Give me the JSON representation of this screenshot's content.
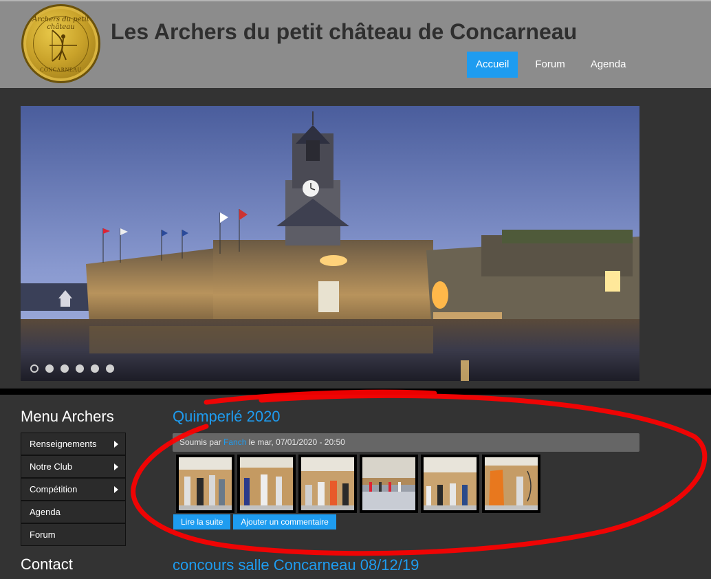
{
  "header": {
    "site_title": "Les Archers du petit château de Concarneau",
    "logo_text_top": "Archers du petit château",
    "logo_text_bottom": "CONCARNEAU"
  },
  "nav": {
    "items": [
      {
        "label": "Accueil",
        "active": true
      },
      {
        "label": "Forum",
        "active": false
      },
      {
        "label": "Agenda",
        "active": false
      }
    ]
  },
  "slider": {
    "image_icon": "castle-photo",
    "slide_count": 6,
    "active_slide": 1
  },
  "sidebar": {
    "menu_title": "Menu Archers",
    "items": [
      {
        "label": "Renseignements",
        "has_submenu": true
      },
      {
        "label": "Notre Club",
        "has_submenu": true
      },
      {
        "label": "Compétition",
        "has_submenu": true
      },
      {
        "label": "Agenda",
        "has_submenu": false
      },
      {
        "label": "Forum",
        "has_submenu": false
      }
    ],
    "contact_title": "Contact"
  },
  "posts": [
    {
      "title": "Quimperlé 2020",
      "meta_prefix": "Soumis par ",
      "author": "Fanch",
      "meta_suffix": " le mar, 07/01/2020 - 20:50",
      "thumbnail_count": 6,
      "read_more": "Lire la suite",
      "add_comment": "Ajouter un commentaire"
    },
    {
      "title": "concours salle Concarneau 08/12/19"
    }
  ],
  "colors": {
    "accent": "#1e9cf0",
    "header_bg": "#8c8c8c",
    "body_bg": "#333333",
    "annotation": "#ff0000"
  }
}
